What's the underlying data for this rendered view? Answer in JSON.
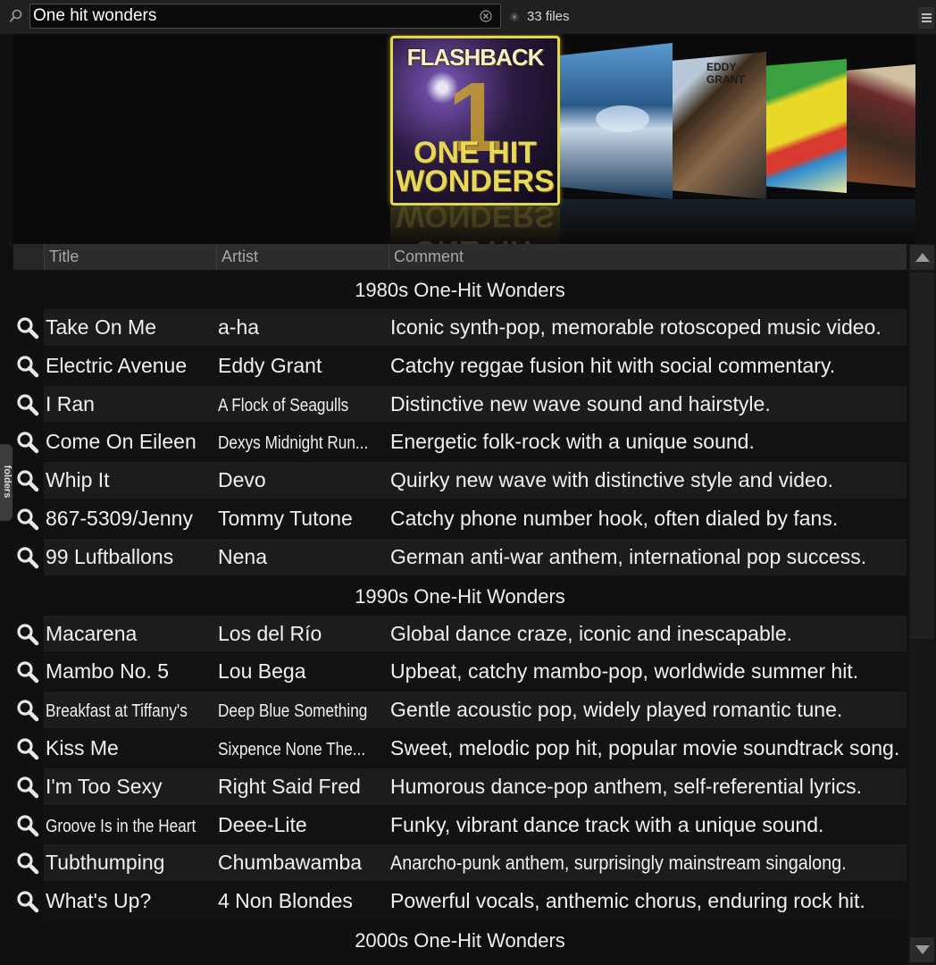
{
  "search": {
    "value": "One hit wonders",
    "file_count": "33 files"
  },
  "coverflow": {
    "main_cover": {
      "title_top": "FLASHBACK",
      "numeral": "1",
      "title_bottom": "ONE HIT WONDERS"
    },
    "side_cover_label": "EDDY GRANT"
  },
  "columns": [
    "Title",
    "Artist",
    "Comment"
  ],
  "groups": [
    {
      "label": "1980s One-Hit Wonders",
      "rows": [
        {
          "title": "Take On Me",
          "artist": "a-ha",
          "comment": "Iconic synth-pop, memorable rotoscoped music video."
        },
        {
          "title": "Electric Avenue",
          "artist": "Eddy Grant",
          "comment": "Catchy reggae fusion hit with social commentary."
        },
        {
          "title": "I Ran",
          "artist": "A Flock of Seagulls",
          "comment": "Distinctive new wave sound and hairstyle."
        },
        {
          "title": "Come On Eileen",
          "artist": "Dexys Midnight Run...",
          "comment": "Energetic folk-rock with a unique sound."
        },
        {
          "title": "Whip It",
          "artist": "Devo",
          "comment": "Quirky new wave with distinctive style and video."
        },
        {
          "title": "867-5309/Jenny",
          "artist": "Tommy Tutone",
          "comment": "Catchy phone number hook, often dialed by fans."
        },
        {
          "title": "99 Luftballons",
          "artist": "Nena",
          "comment": "German anti-war anthem, international pop success."
        }
      ]
    },
    {
      "label": "1990s One-Hit Wonders",
      "rows": [
        {
          "title": "Macarena",
          "artist": "Los del Río",
          "comment": "Global dance craze, iconic and inescapable."
        },
        {
          "title": "Mambo No. 5",
          "artist": "Lou Bega",
          "comment": "Upbeat, catchy mambo-pop, worldwide summer hit."
        },
        {
          "title": "Breakfast at Tiffany's",
          "artist": "Deep Blue Something",
          "comment": "Gentle acoustic pop, widely played romantic tune."
        },
        {
          "title": "Kiss Me",
          "artist": "Sixpence None The...",
          "comment": "Sweet, melodic pop hit, popular movie soundtrack song."
        },
        {
          "title": "I'm Too Sexy",
          "artist": "Right Said Fred",
          "comment": "Humorous dance-pop anthem, self-referential lyrics."
        },
        {
          "title": "Groove Is in the Heart",
          "artist": "Deee-Lite",
          "comment": "Funky, vibrant dance track with a unique sound."
        },
        {
          "title": "Tubthumping",
          "artist": "Chumbawamba",
          "comment": "Anarcho-punk anthem, surprisingly mainstream singalong."
        },
        {
          "title": "What's Up?",
          "artist": "4 Non Blondes",
          "comment": "Powerful vocals, anthemic chorus, enduring rock hit."
        }
      ]
    },
    {
      "label": "2000s One-Hit Wonders",
      "rows": []
    }
  ],
  "side_tab": "folders",
  "icons": {
    "search": "magnifier-icon",
    "clear": "clear-circle-icon",
    "menu": "hamburger-menu-icon",
    "scroll_up": "arrow-up-icon",
    "scroll_down": "arrow-down-icon"
  },
  "colors": {
    "background": "#101010",
    "row_alt": "#1c1c1c",
    "header": "#2c2c2c",
    "cover_highlight": "#e4d64a"
  }
}
